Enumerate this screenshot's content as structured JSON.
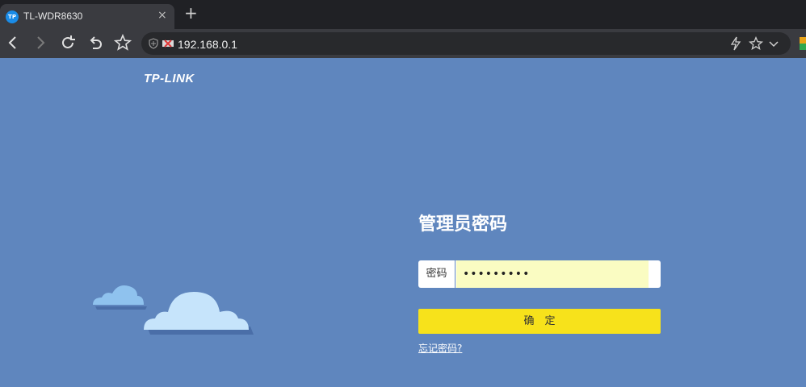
{
  "browser": {
    "tab_title": "TL-WDR8630",
    "tab_favicon_text": "TP",
    "tab_close": "×",
    "new_tab": "+",
    "url": "192.168.0.1",
    "icons": [
      "back-icon",
      "forward-icon",
      "reload-icon",
      "undo-icon",
      "bookmark-star-icon",
      "shield-icon",
      "not-secure-icon",
      "lightning-icon",
      "favorite-star-icon",
      "chevron-down-icon",
      "extension-icon"
    ]
  },
  "page": {
    "logo": "TP-LINK",
    "heading": "管理员密码",
    "password_label": "密码",
    "password_value": "•••••••••",
    "confirm_label": "确　定",
    "forgot_link": "忘记密码?"
  },
  "colors": {
    "page_background": "#5f86be",
    "button": "#f7e21b",
    "input_fill": "#fafcc2"
  }
}
